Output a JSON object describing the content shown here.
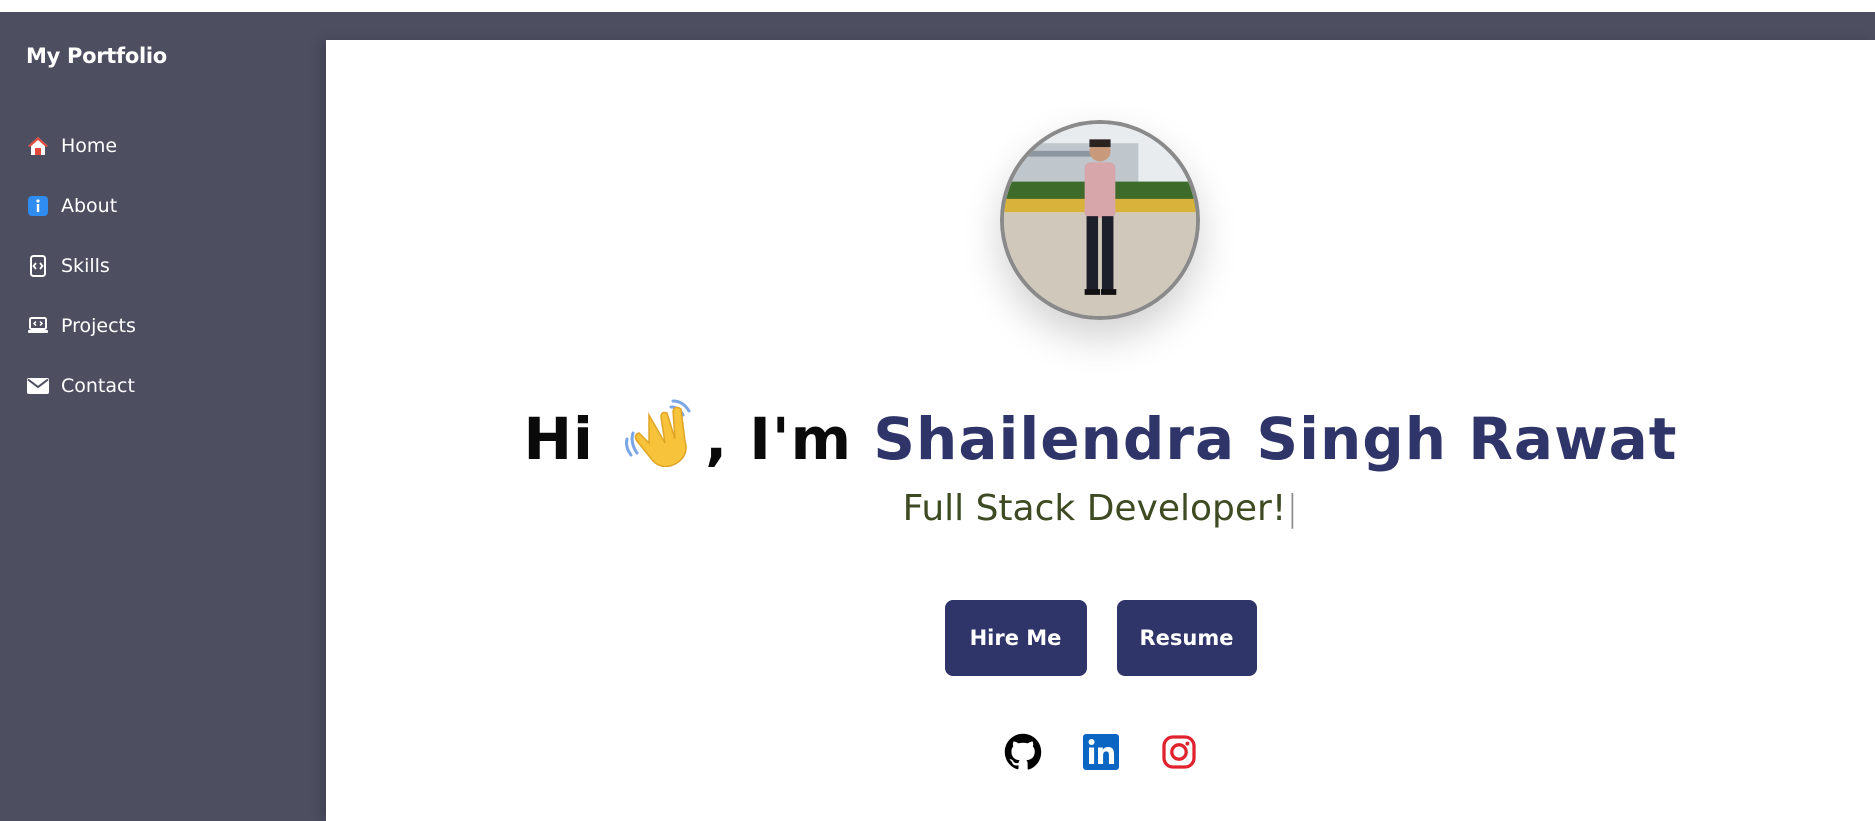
{
  "sidebar": {
    "brand": "My Portfolio",
    "items": [
      {
        "label": "Home",
        "icon": "house-icon"
      },
      {
        "label": "About",
        "icon": "info-icon"
      },
      {
        "label": "Skills",
        "icon": "code-phone-icon"
      },
      {
        "label": "Projects",
        "icon": "laptop-code-icon"
      },
      {
        "label": "Contact",
        "icon": "envelope-icon"
      }
    ]
  },
  "hero": {
    "greeting_prefix": "Hi",
    "greeting_mid": ", I'm",
    "name": "Shailendra Singh Rawat",
    "subtitle": "Full Stack Developer!",
    "cursor": "|",
    "wave_icon": "waving-hand-icon",
    "avatar": "profile-photo"
  },
  "buttons": {
    "hire": "Hire Me",
    "resume": "Resume"
  },
  "socials": [
    {
      "icon": "github-icon",
      "color": "#000000"
    },
    {
      "icon": "linkedin-icon",
      "color": "#0a66c2"
    },
    {
      "icon": "instagram-icon",
      "color": "#e0232e"
    }
  ],
  "colors": {
    "sidebar_bg": "#4d4f61",
    "accent": "#2f3569",
    "subtitle": "#3d4a22"
  }
}
